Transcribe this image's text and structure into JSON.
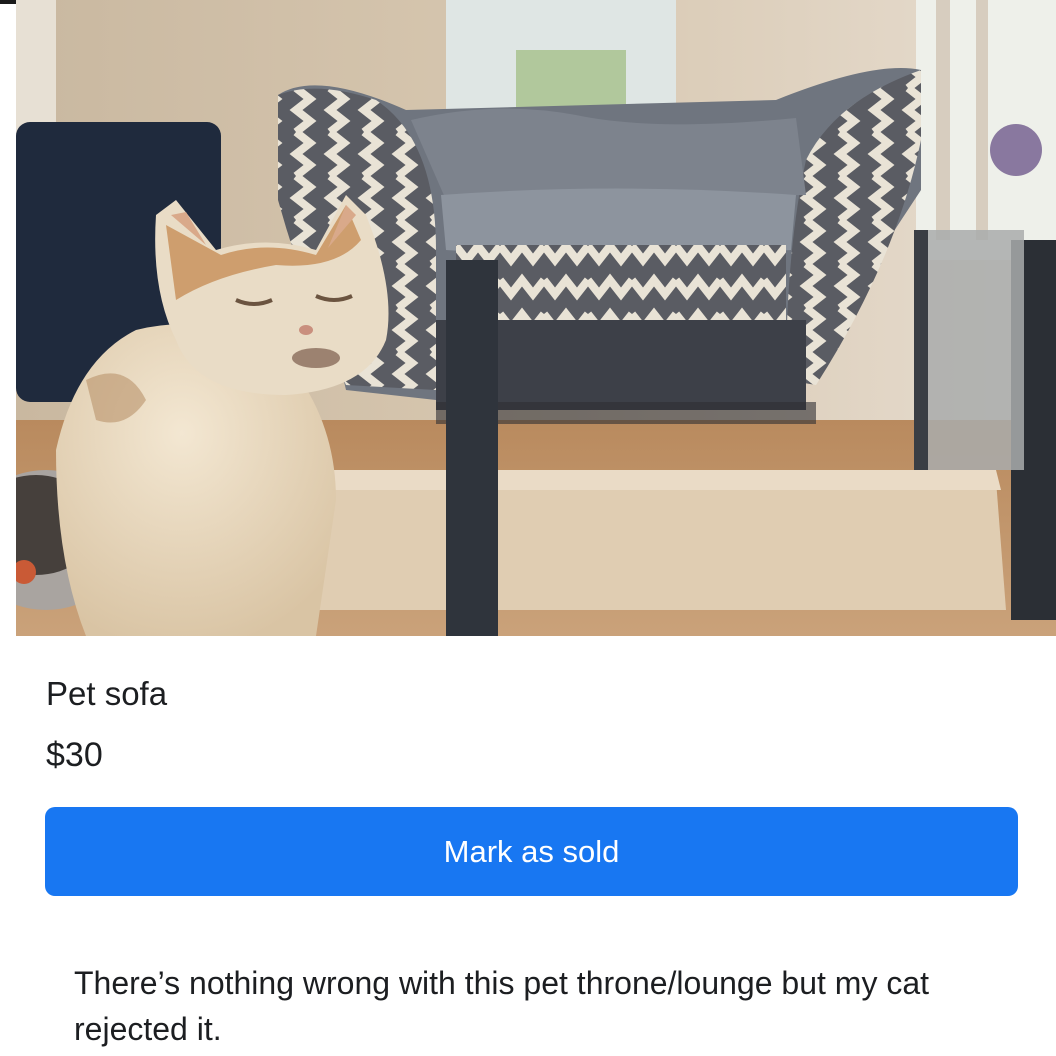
{
  "listing": {
    "title": "Pet sofa",
    "price": "$30",
    "description": "There’s nothing wrong with this pet throne/lounge but my cat rejected it."
  },
  "actions": {
    "mark_sold_label": "Mark as sold"
  },
  "colors": {
    "primary_button": "#1877f2",
    "text": "#1c1e21",
    "background": "#ffffff"
  }
}
